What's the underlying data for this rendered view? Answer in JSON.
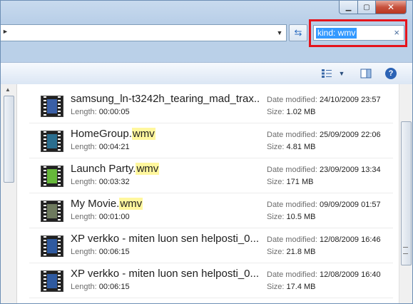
{
  "window": {
    "min_label": "▁",
    "max_label": "▢",
    "close_label": "✕"
  },
  "address": {
    "arrow_icon": "chevron-right-icon",
    "dropdown_icon": "chevron-down-icon"
  },
  "search": {
    "query": "kind: wmv",
    "clear_label": "×",
    "highlight_color": "#e5141c"
  },
  "toolbar": {
    "views_icon": "views-icon",
    "views_arrow": "▼",
    "preview_icon": "preview-pane-icon",
    "help_label": "?"
  },
  "files": [
    {
      "name": "samsung_ln-t3242h_tearing_mad_trax...",
      "name_hl": "",
      "length_label": "Length:",
      "length": "00:00:05",
      "date_label": "Date modified:",
      "date": "24/10/2009 23:57",
      "size_label": "Size:",
      "size": "1.02 MB",
      "thumb": "#3a5fa6"
    },
    {
      "name": "HomeGroup.",
      "name_hl": "wmv",
      "length_label": "Length:",
      "length": "00:04:21",
      "date_label": "Date modified:",
      "date": "25/09/2009 22:06",
      "size_label": "Size:",
      "size": "4.81 MB",
      "thumb": "#2b6e8f"
    },
    {
      "name": "Launch Party.",
      "name_hl": "wmv",
      "length_label": "Length:",
      "length": "00:03:32",
      "date_label": "Date modified:",
      "date": "23/09/2009 13:34",
      "size_label": "Size:",
      "size": "171 MB",
      "thumb": "#66b83a"
    },
    {
      "name": "My Movie.",
      "name_hl": "wmv",
      "length_label": "Length:",
      "length": "00:01:00",
      "date_label": "Date modified:",
      "date": "09/09/2009 01:57",
      "size_label": "Size:",
      "size": "10.5 MB",
      "thumb": "#6e7a5e"
    },
    {
      "name": "XP verkko - miten luon sen helposti_0...",
      "name_hl": "",
      "length_label": "Length:",
      "length": "00:06:15",
      "date_label": "Date modified:",
      "date": "12/08/2009 16:46",
      "size_label": "Size:",
      "size": "21.8 MB",
      "thumb": "#2f5aa0"
    },
    {
      "name": "XP verkko - miten luon sen helposti_0...",
      "name_hl": "",
      "length_label": "Length:",
      "length": "00:06:15",
      "date_label": "Date modified:",
      "date": "12/08/2009 16:40",
      "size_label": "Size:",
      "size": "17.4 MB",
      "thumb": "#2f5aa0"
    }
  ]
}
